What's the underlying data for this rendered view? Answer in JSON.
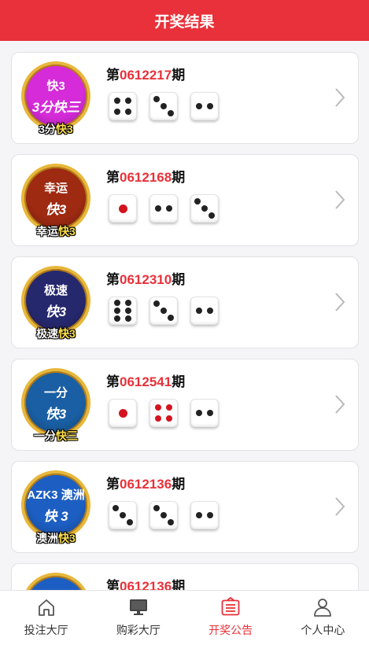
{
  "header": {
    "title": "开奖结果"
  },
  "issue_prefix": "第",
  "issue_suffix": "期",
  "lotteries": [
    {
      "logo_top": "快3",
      "logo_sub": "3分快三",
      "caption_a": "3分",
      "caption_b": "快3",
      "color": "#d52bd9",
      "issue": "0612217",
      "dice": [
        4,
        3,
        2
      ],
      "dice_style": "normal"
    },
    {
      "logo_top": "幸运",
      "logo_sub": "快3",
      "caption_a": "幸运",
      "caption_b": "快3",
      "color": "#9e2a12",
      "issue": "0612168",
      "dice": [
        1,
        2,
        3
      ],
      "dice_style": "normal"
    },
    {
      "logo_top": "极速",
      "logo_sub": "快3",
      "caption_a": "极速",
      "caption_b": "快3",
      "color": "#26286e",
      "issue": "0612310",
      "dice": [
        6,
        3,
        2
      ],
      "dice_style": "normal"
    },
    {
      "logo_top": "一分",
      "logo_sub": "快3",
      "caption_a": "一分",
      "caption_b": "快三",
      "color": "#1a5fa3",
      "issue": "0612541",
      "dice": [
        1,
        4,
        2
      ],
      "dice_style": "red4"
    },
    {
      "logo_top": "AZK3 澳洲",
      "logo_sub": "快 3",
      "caption_a": "澳洲",
      "caption_b": "快3",
      "color": "#1d5ec2",
      "issue": "0612136",
      "dice": [
        3,
        3,
        2
      ],
      "dice_style": "normal"
    },
    {
      "logo_top": "",
      "logo_sub": "",
      "caption_a": "",
      "caption_b": "",
      "color": "#1d5ec2",
      "issue": "0612136",
      "dice": [],
      "dice_style": "normal"
    }
  ],
  "tabs": [
    {
      "label": "投注大厅",
      "icon": "home-icon",
      "active": false
    },
    {
      "label": "购彩大厅",
      "icon": "monitor-icon",
      "active": false
    },
    {
      "label": "开奖公告",
      "icon": "announcement-icon",
      "active": true
    },
    {
      "label": "个人中心",
      "icon": "user-icon",
      "active": false
    }
  ],
  "colors": {
    "brand_red": "#e8313a",
    "gold": "#e7b73a"
  }
}
